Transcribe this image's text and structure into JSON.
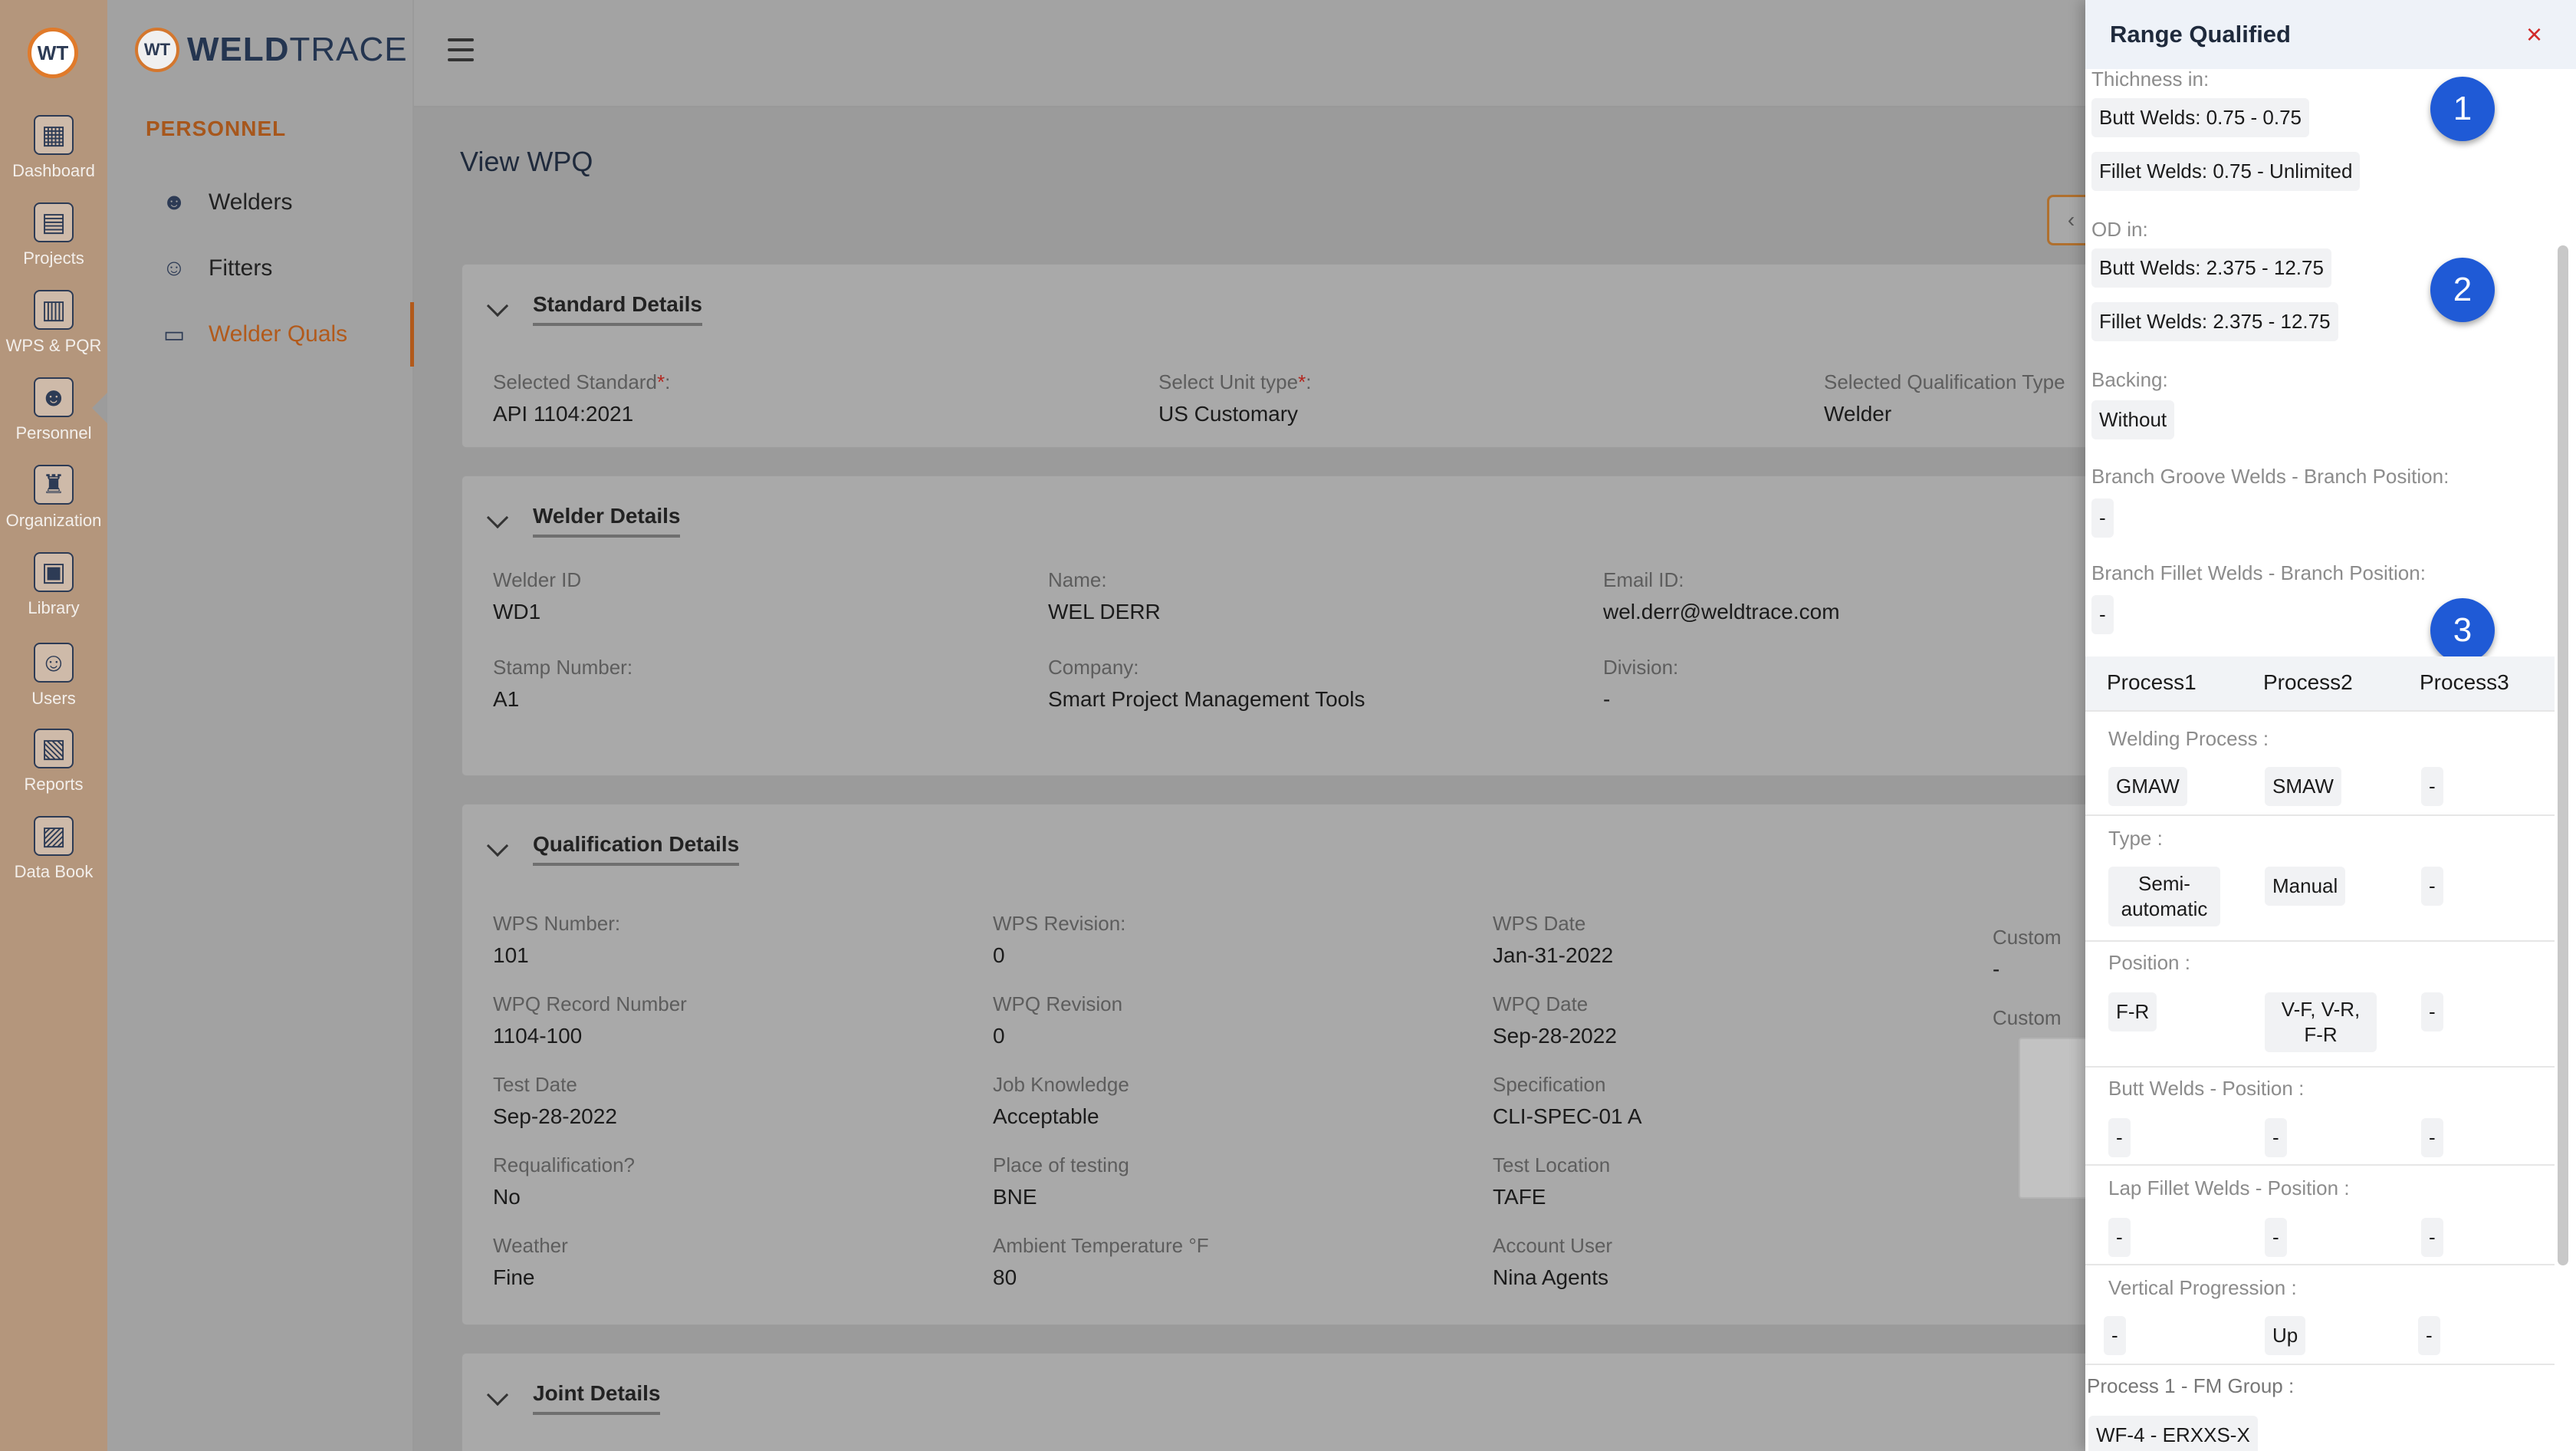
{
  "rail": {
    "logo": "WT",
    "items": [
      {
        "label": "Dashboard",
        "icon": "dashboard-icon",
        "glyph": "▦"
      },
      {
        "label": "Projects",
        "icon": "projects-icon",
        "glyph": "▤"
      },
      {
        "label": "WPS & PQR",
        "icon": "wps-pqr-icon",
        "glyph": "▥"
      },
      {
        "label": "Personnel",
        "icon": "personnel-icon",
        "glyph": "☻"
      },
      {
        "label": "Organization",
        "icon": "organization-icon",
        "glyph": "♜"
      },
      {
        "label": "Library",
        "icon": "library-icon",
        "glyph": "▣"
      },
      {
        "label": "Users",
        "icon": "users-icon",
        "glyph": "☺"
      },
      {
        "label": "Reports",
        "icon": "reports-icon",
        "glyph": "▧"
      },
      {
        "label": "Data Book",
        "icon": "data-book-icon",
        "glyph": "▨"
      }
    ]
  },
  "sidebar": {
    "brand_badge": "WT",
    "brand_bold": "WELD",
    "brand_light": "TRACE",
    "section": "PERSONNEL",
    "items": [
      {
        "label": "Welders",
        "glyph": "☻"
      },
      {
        "label": "Fitters",
        "glyph": "☺"
      },
      {
        "label": "Welder Quals",
        "glyph": "▭"
      }
    ]
  },
  "main": {
    "title": "View WPQ",
    "back_glyph": "‹",
    "standard": {
      "title": "Standard Details",
      "selected_standard_label": "Selected Standard",
      "selected_standard": "API 1104:2021",
      "unit_type_label": "Select Unit type",
      "unit_type": "US Customary",
      "qualification_type_label": "Selected Qualification Type",
      "qualification_type": "Welder",
      "required_mark": "*",
      "colon": ":"
    },
    "welder": {
      "title": "Welder Details",
      "fields": [
        {
          "k": "Welder ID",
          "v": "WD1"
        },
        {
          "k": "Name:",
          "v": "WEL DERR"
        },
        {
          "k": "Email ID:",
          "v": "wel.derr@weldtrace.com"
        },
        {
          "k": "Stamp Number:",
          "v": "A1"
        },
        {
          "k": "Company:",
          "v": "Smart Project Management Tools"
        },
        {
          "k": "Division:",
          "v": "-"
        }
      ]
    },
    "qualification": {
      "title": "Qualification Details",
      "fields": [
        {
          "k": "WPS Number:",
          "v": "101"
        },
        {
          "k": "WPS Revision:",
          "v": "0"
        },
        {
          "k": "WPS Date",
          "v": "Jan-31-2022"
        },
        {
          "k": "Custom",
          "v": "-"
        },
        {
          "k": "WPQ Record Number",
          "v": "1104-100"
        },
        {
          "k": "WPQ Revision",
          "v": "0"
        },
        {
          "k": "WPQ Date",
          "v": "Sep-28-2022"
        },
        {
          "k": "Custom",
          "v": ""
        },
        {
          "k": "Test Date",
          "v": "Sep-28-2022"
        },
        {
          "k": "Job Knowledge",
          "v": "Acceptable"
        },
        {
          "k": "Specification",
          "v": "CLI-SPEC-01 A"
        },
        {
          "k": "Requalification?",
          "v": "No"
        },
        {
          "k": "Place of testing",
          "v": "BNE"
        },
        {
          "k": "Test Location",
          "v": "TAFE"
        },
        {
          "k": "Weather",
          "v": "Fine"
        },
        {
          "k": "Ambient Temperature °F",
          "v": "80"
        },
        {
          "k": "Account User",
          "v": "Nina Agents"
        }
      ]
    },
    "joint": {
      "title": "Joint Details"
    }
  },
  "drawer": {
    "title": "Range Qualified",
    "close": "×",
    "thickness_label": "Thichness in:",
    "thickness_butt": "Butt Welds: 0.75 - 0.75",
    "thickness_fillet": "Fillet Welds: 0.75 - Unlimited",
    "od_label": "OD in:",
    "od_butt": "Butt Welds: 2.375 - 12.75",
    "od_fillet": "Fillet Welds: 2.375 - 12.75",
    "backing_label": "Backing:",
    "backing": "Without",
    "branch_groove_label": "Branch Groove Welds - Branch Position:",
    "branch_groove": "-",
    "branch_fillet_label": "Branch Fillet Welds - Branch Position:",
    "branch_fillet": "-",
    "steps": [
      "1",
      "2",
      "3"
    ],
    "process_cols": [
      "Process1",
      "Process2",
      "Process3"
    ],
    "rows": [
      {
        "label": "Welding Process :",
        "values": [
          "GMAW",
          "SMAW",
          "-"
        ]
      },
      {
        "label": "Type :",
        "values": [
          "Semi-automatic",
          "Manual",
          "-"
        ]
      },
      {
        "label": "Position :",
        "values": [
          "F-R",
          "V-F, V-R, F-R",
          "-"
        ]
      },
      {
        "label": "Butt Welds - Position :",
        "values": [
          "-",
          "-",
          "-"
        ]
      },
      {
        "label": "Lap Fillet Welds - Position :",
        "values": [
          "-",
          "-",
          "-"
        ]
      },
      {
        "label": "Vertical Progression :",
        "values": [
          "-",
          "Up",
          "-"
        ]
      }
    ],
    "fm_group_label": "Process 1 - FM Group :",
    "fm_group": "WF-4 - ERXXS-X"
  }
}
